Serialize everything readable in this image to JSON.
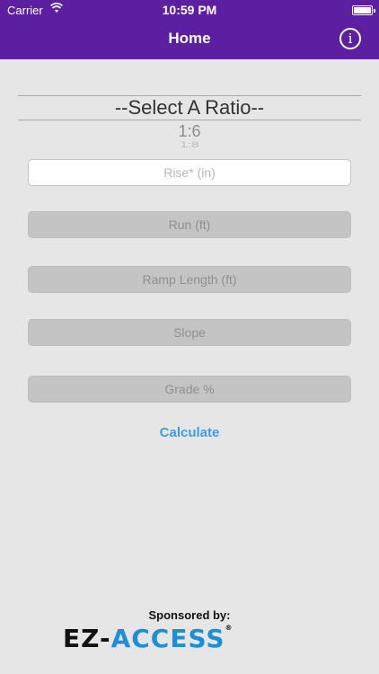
{
  "status_bar": {
    "carrier": "Carrier",
    "time": "10:59 PM"
  },
  "nav": {
    "title": "Home",
    "info_icon": "info-icon"
  },
  "ratio_picker": {
    "selected": "--Select A Ratio--",
    "next_option": "1:6",
    "following_option": "1:8"
  },
  "fields": {
    "rise_placeholder": "Rise* (in)",
    "run_placeholder": "Run (ft)",
    "ramp_length_placeholder": "Ramp Length (ft)",
    "slope_placeholder": "Slope",
    "grade_placeholder": "Grade %"
  },
  "calculate_label": "Calculate",
  "sponsor": {
    "label": "Sponsored by:",
    "logo_left": "EZ-",
    "logo_right": "ACCESS",
    "logo_mark": "®"
  },
  "colors": {
    "header": "#5c1fa2",
    "accent": "#3d9ee0",
    "logo_blue": "#1d8fd6"
  }
}
